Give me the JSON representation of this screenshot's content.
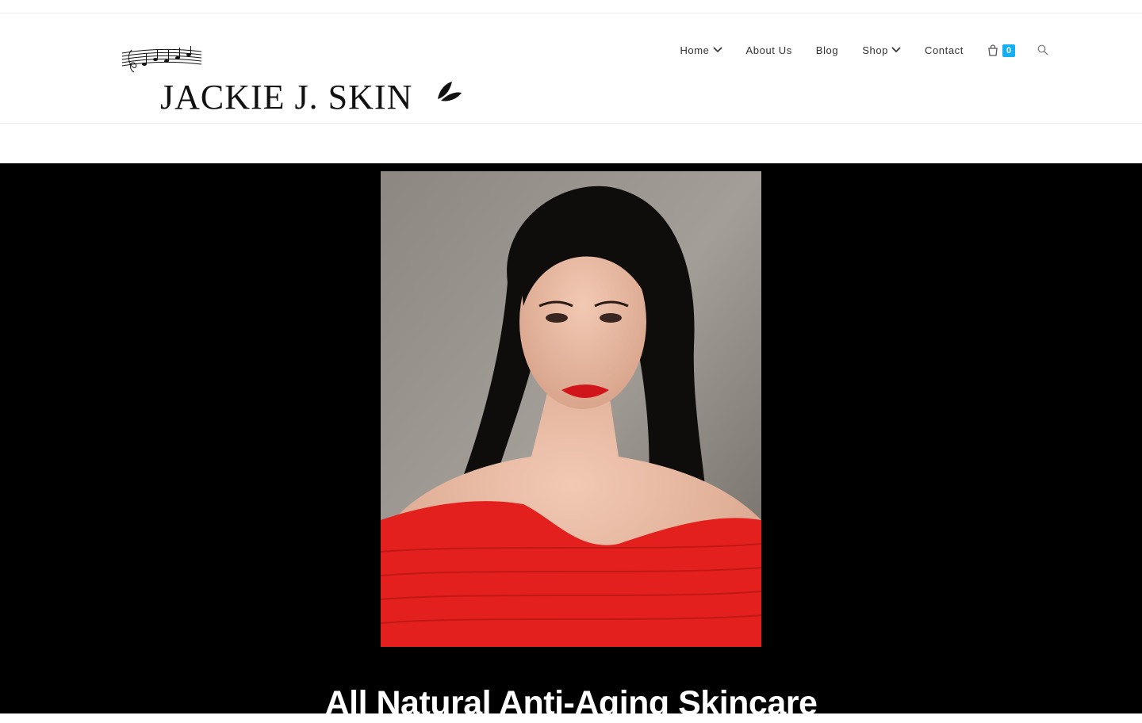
{
  "site": {
    "logo_text": "JACKIE J. SKIN"
  },
  "nav": {
    "items": [
      {
        "label": "Home",
        "has_dropdown": true
      },
      {
        "label": "About Us",
        "has_dropdown": false
      },
      {
        "label": "Blog",
        "has_dropdown": false
      },
      {
        "label": "Shop",
        "has_dropdown": true
      },
      {
        "label": "Contact",
        "has_dropdown": false
      }
    ],
    "cart_count": "0",
    "cart_icon": "shopping-bag-icon",
    "search_icon": "search-icon"
  },
  "hero": {
    "title": "All Natural Anti-Aging Skincare",
    "image_alt": "Portrait of woman in red off-shoulder top"
  },
  "colors": {
    "accent": "#13aff0",
    "hero_bg": "#000000",
    "nav_text": "#333333"
  }
}
